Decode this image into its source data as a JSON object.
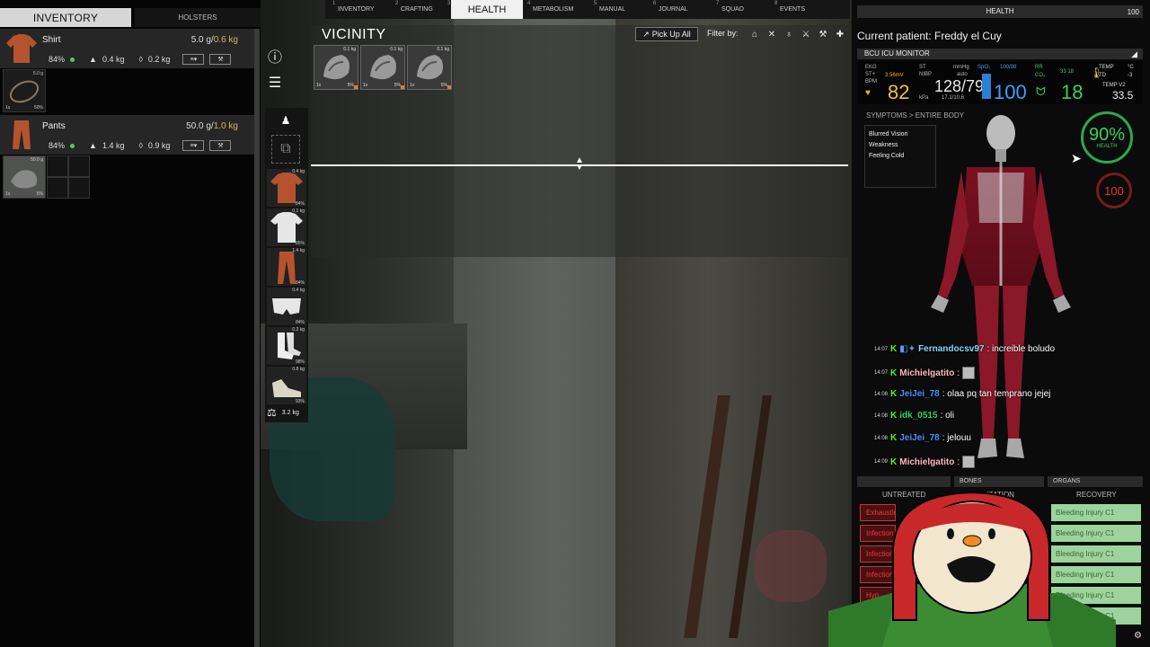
{
  "left_panel": {
    "tab_inventory": "INVENTORY",
    "tab_holsters": "HOLSTERS",
    "shirt": {
      "name": "Shirt",
      "weight": "5.0 g/",
      "capacity": "0.6 kg",
      "condition": "84%",
      "stat1": "0.4 kg",
      "stat2": "0.2 kg"
    },
    "shirt_slot": {
      "weight": "5.0 g",
      "qty": "1x",
      "cond": "50%"
    },
    "pants": {
      "name": "Pants",
      "weight": "50.0 g/",
      "capacity": "1.0 kg",
      "condition": "84%",
      "stat1": "1.4 kg",
      "stat2": "0.9 kg"
    },
    "pants_slot": {
      "weight": "50.0 g",
      "qty": "1x",
      "cond": "5%"
    }
  },
  "body_slots": [
    {
      "weight": "0.4 kg",
      "cond": "84%"
    },
    {
      "weight": "0.1 kg",
      "cond": "85%"
    },
    {
      "weight": "1.4 kg",
      "cond": "84%"
    },
    {
      "weight": "0.4 kg",
      "cond": "84%"
    },
    {
      "weight": "0.2 kg",
      "cond": "98%"
    },
    {
      "weight": "0.8 kg",
      "cond": "93%"
    }
  ],
  "total_weight": "3.2 kg",
  "top_nav": [
    {
      "num": "1",
      "label": "INVENTORY"
    },
    {
      "num": "2",
      "label": "CRAFTING"
    },
    {
      "num": "3",
      "label": "HEALTH"
    },
    {
      "num": "4",
      "label": "METABOLISM"
    },
    {
      "num": "5",
      "label": "MANUAL"
    },
    {
      "num": "6",
      "label": "JOURNAL"
    },
    {
      "num": "7",
      "label": "SQUAD"
    },
    {
      "num": "8",
      "label": "EVENTS"
    }
  ],
  "vicinity": {
    "title": "VICINITY",
    "pickup_label": "Pick Up All",
    "filter_label": "Filter by:",
    "items": [
      {
        "weight": "0.1 kg",
        "qty": "1x",
        "cond": "5%"
      },
      {
        "weight": "0.1 kg",
        "qty": "1x",
        "cond": "5%"
      },
      {
        "weight": "0.1 kg",
        "qty": "1x",
        "cond": "5%"
      }
    ]
  },
  "health": {
    "bar_label": "HEALTH",
    "bar_value": "100",
    "patient": "Current patient: Freddy el Cuy",
    "icu_title": "BCU ICU MONITOR",
    "ekg_label": "EKG",
    "ekg_sub1": "ST+",
    "ekg_sub2": "BPM",
    "ekg_mv": "3.56mV",
    "bpm": "82",
    "st_label": "ST",
    "nibp_label": "NIBP",
    "mmhg": "mmHg",
    "auto": "auto",
    "kpa_label": "kPa",
    "kpa_value": "17.1/10.6",
    "bp": "128/79",
    "spo2_label": "SpO₂",
    "spo2_range": "100/98",
    "spo2": "100",
    "rr_label": "RR",
    "co2_label": "CO₂",
    "rr_range": "33 18",
    "rr": "18",
    "temp_label": "TEMP",
    "td_label": "TD",
    "temp_unit": "°C",
    "td_value": "-3",
    "temp2_label": "TEMP V2",
    "temp": "33.5",
    "symptoms_title": "SYMPTOMS > ENTIRE BODY",
    "symptoms": [
      "Blurred Vision",
      "Weakness",
      "Feeling Cold"
    ],
    "health_pct": "90%",
    "health_word": "HEALTH",
    "blood": "100",
    "tabs": [
      "",
      "BONES",
      "ORGANS"
    ],
    "col_untreated": "UNTREATED",
    "col_stabilization": "IZATION",
    "col_recovery": "RECOVERY",
    "untreated": [
      "Exhaustion",
      "Infection",
      "Infection",
      "Infection",
      "Hyp"
    ],
    "recovery": [
      "Bleeding Injury C1",
      "Bleeding Injury C1",
      "Bleeding Injury C1",
      "Bleeding Injury C1",
      "Bleeding Injury C1",
      "Bleeding Injury C1"
    ]
  },
  "chat": [
    {
      "time": "14:07",
      "user": "Fernandocsv97",
      "msg": ": increible boludo",
      "color": "#7fd9ff"
    },
    {
      "time": "14:07",
      "user": "Michielgatito",
      "msg": ":",
      "color": "#ffb6c1"
    },
    {
      "time": "14:08",
      "user": "JeiJei_78",
      "msg": ": olaa pq tan temprano jejej",
      "color": "#4a90ff"
    },
    {
      "time": "14:08",
      "user": "idk_0515",
      "msg": ": oli",
      "color": "#2bd46b"
    },
    {
      "time": "14:08",
      "user": "JeiJei_78",
      "msg": ": jelouu",
      "color": "#4a90ff"
    },
    {
      "time": "14:09",
      "user": "Michielgatito",
      "msg": ":",
      "color": "#ffb6c1"
    }
  ],
  "colors": {
    "accent_green": "#3ccf5a",
    "red": "#e33333",
    "orange": "#e07a2a"
  }
}
